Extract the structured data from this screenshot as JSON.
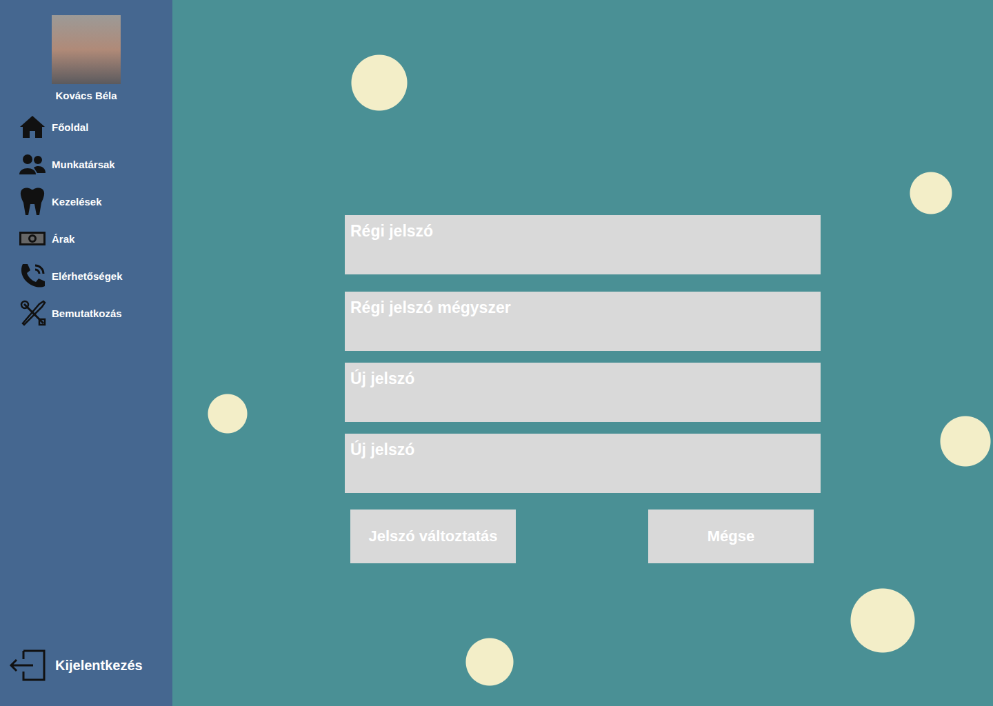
{
  "user": {
    "name": "Kovács Béla"
  },
  "sidebar": {
    "items": [
      {
        "label": "Főoldal",
        "icon": "home",
        "selected": false
      },
      {
        "label": "Munkatársak",
        "icon": "users",
        "selected": false
      },
      {
        "label": "Kezelések",
        "icon": "tooth",
        "selected": false
      },
      {
        "label": "Árak",
        "icon": "money",
        "selected": false
      },
      {
        "label": "Elérhetőségek",
        "icon": "phone",
        "selected": false
      },
      {
        "label": "Bemutatkozás",
        "icon": "tools",
        "selected": false
      }
    ],
    "logout": "Kijelentkezés"
  },
  "form": {
    "fields": [
      {
        "label": "Régi jelszó"
      },
      {
        "label": "Régi jelszó mégyszer"
      },
      {
        "label": "Új jelszó"
      },
      {
        "label": "Új jelszó"
      }
    ],
    "buttons": [
      "Jelszó változtatás",
      "Mégse"
    ]
  }
}
